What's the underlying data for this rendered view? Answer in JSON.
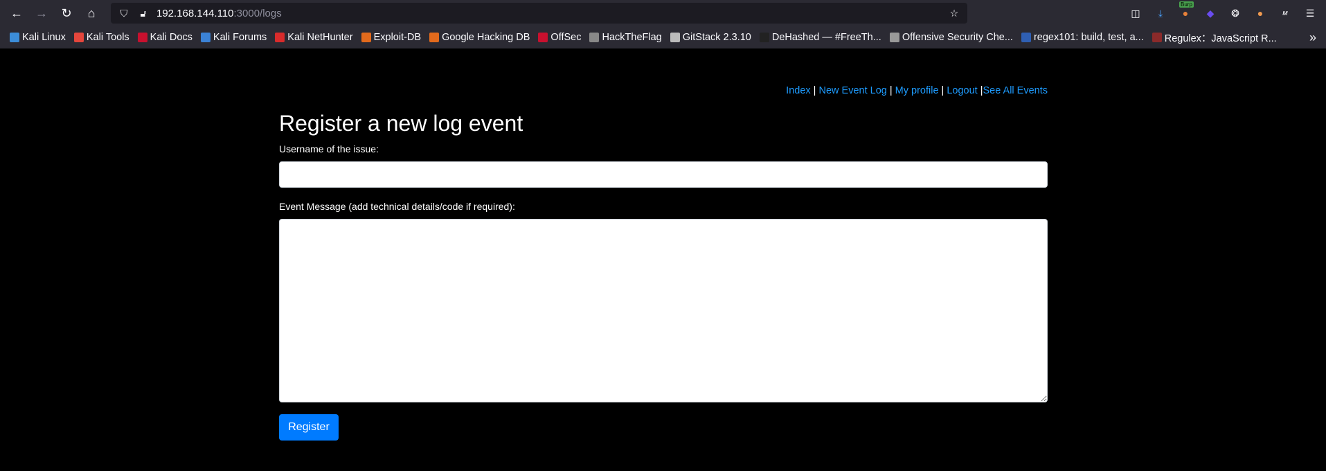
{
  "browser": {
    "url_host": "192.168.144.110",
    "url_path": ":3000/logs",
    "bookmarks": [
      {
        "label": "Kali Linux",
        "color": "#3c8dd9"
      },
      {
        "label": "Kali Tools",
        "color": "#e5463c"
      },
      {
        "label": "Kali Docs",
        "color": "#c8102e"
      },
      {
        "label": "Kali Forums",
        "color": "#3b82d6"
      },
      {
        "label": "Kali NetHunter",
        "color": "#d92b2b"
      },
      {
        "label": "Exploit-DB",
        "color": "#e26a1c"
      },
      {
        "label": "Google Hacking DB",
        "color": "#e26a1c"
      },
      {
        "label": "OffSec",
        "color": "#c8102e"
      },
      {
        "label": "HackTheFlag",
        "color": "#888888"
      },
      {
        "label": "GitStack 2.3.10",
        "color": "#bbbbbb"
      },
      {
        "label": "DeHashed — #FreeTh...",
        "color": "#222222"
      },
      {
        "label": "Offensive Security Che...",
        "color": "#999999"
      },
      {
        "label": "regex101: build, test, a...",
        "color": "#2f5fb3"
      },
      {
        "label": "Regulex：JavaScript R...",
        "color": "#8b2a2a"
      }
    ],
    "extensions": [
      "pocket-icon",
      "download-icon",
      "burp-icon",
      "shield-icon",
      "cookie-icon",
      "ext-icon",
      "wappalyzer-icon",
      "menu-icon"
    ],
    "burp_badge": "Burp"
  },
  "nav": {
    "index": "Index",
    "new_event_log": "New Event Log",
    "my_profile": "My profile",
    "logout": "Logout",
    "see_all_events": "See All Events",
    "sep": " | "
  },
  "form": {
    "title": "Register a new log event",
    "username_label": "Username of the issue:",
    "username_value": "",
    "message_label": "Event Message (add technical details/code if required):",
    "message_value": "",
    "submit_label": "Register"
  },
  "colors": {
    "link": "#1e9cff",
    "button": "#007bff"
  }
}
